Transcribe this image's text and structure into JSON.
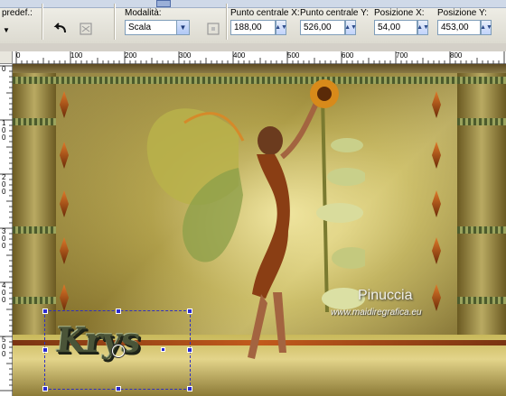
{
  "toolbar": {
    "presets_label": "predef.:",
    "mode_label": "Modalità:",
    "mode_value": "Scala",
    "center_x_label": "Punto centrale X:",
    "center_x_value": "188,00",
    "center_y_label": "Punto centrale Y:",
    "center_y_value": "526,00",
    "pos_x_label": "Posizione X:",
    "pos_x_value": "54,00",
    "pos_y_label": "Posizione Y:",
    "pos_y_value": "453,00"
  },
  "ruler": {
    "h_labels": [
      "0",
      "100",
      "200",
      "300",
      "400",
      "500",
      "600",
      "700",
      "800"
    ],
    "v_labels": [
      "0",
      "1\n0\n0",
      "2\n0\n0",
      "3\n0\n0",
      "4\n0\n0",
      "5\n0\n0"
    ]
  },
  "canvas": {
    "watermark_name": "Pinuccia",
    "watermark_url": "www.maidiregrafica.eu",
    "overlay_text": "Krys"
  },
  "colors": {
    "accent": "#3030c0",
    "toolbar_bg": "#e8e6dd"
  }
}
